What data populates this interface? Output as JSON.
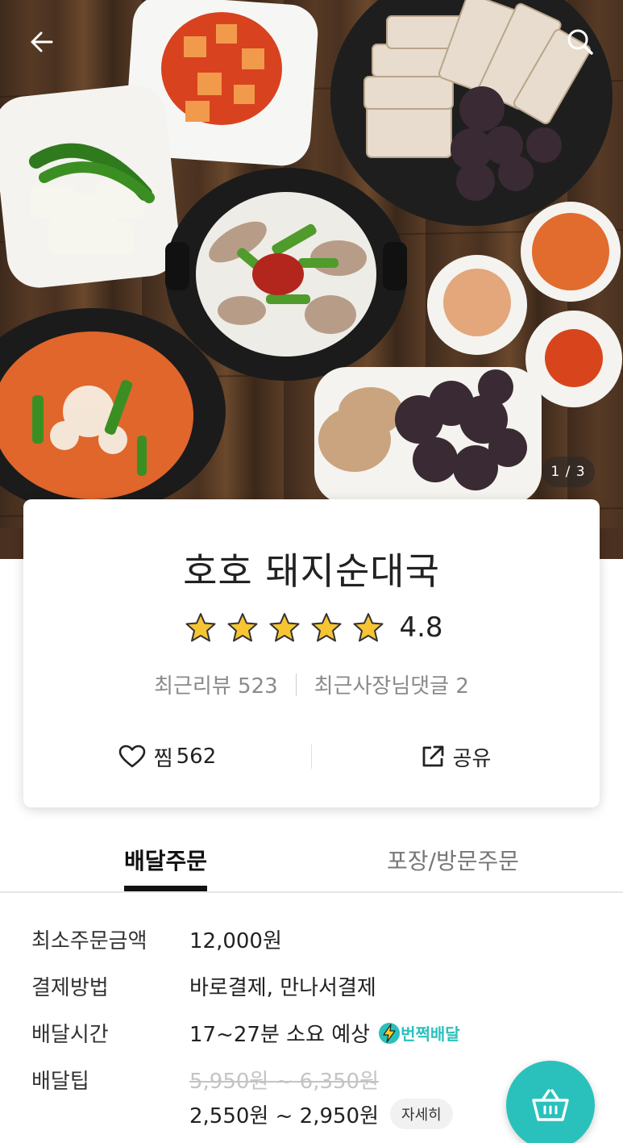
{
  "hero": {
    "image_counter": "1 / 3",
    "back_icon": "back-arrow-icon",
    "search_icon": "search-icon"
  },
  "store": {
    "name": "호호 돼지순대국",
    "rating": "4.8",
    "star_count": 5,
    "recent_reviews": "최근리뷰 523",
    "recent_owner_replies": "최근사장님댓글 2"
  },
  "actions": {
    "favorite_label": "찜",
    "favorite_count": "562",
    "share_label": "공유"
  },
  "tabs": {
    "delivery": "배달주문",
    "pickup": "포장/방문주문",
    "active": "delivery"
  },
  "info": {
    "min_order": {
      "label": "최소주문금액",
      "value": "12,000원"
    },
    "payment": {
      "label": "결제방법",
      "value": "바로결제, 만나서결제"
    },
    "delivery_time": {
      "label": "배달시간",
      "value": "17~27분 소요 예상",
      "badge": "번쩍배달"
    },
    "delivery_tip": {
      "label": "배달팁",
      "original": "5,950원 ~ 6,350원",
      "discounted": "2,550원 ~ 2,950원",
      "detail_button": "자세히"
    }
  },
  "colors": {
    "accent": "#2ac1bc",
    "star": "#f7c531"
  }
}
